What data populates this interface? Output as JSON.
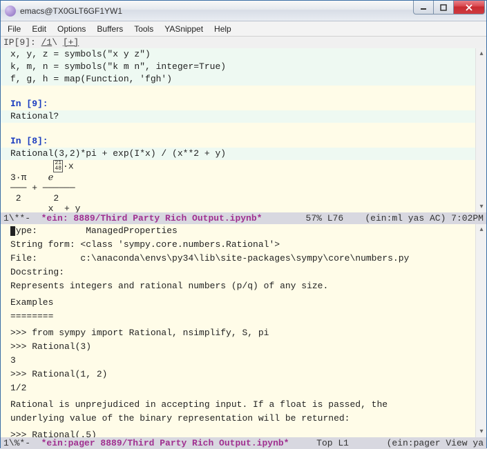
{
  "window": {
    "title": "emacs@TX0GLT6GF1YW1"
  },
  "menu": {
    "file": "File",
    "edit": "Edit",
    "options": "Options",
    "buffers": "Buffers",
    "tools": "Tools",
    "yasnippet": "YASnippet",
    "help": "Help"
  },
  "tab": {
    "prefix": "IP[9]: ",
    "frac": "/1",
    "suffix": "\\ ",
    "plus": "[+]"
  },
  "top": {
    "l1": "x, y, z = symbols(\"x y z\")",
    "l2": "k, m, n = symbols(\"k m n\", integer=True)",
    "l3": "f, g, h = map(Function, 'fgh')",
    "inp9": "In [9]:",
    "l4": "Rational?",
    "inp8": "In [8]:",
    "l5": "Rational(3,2)*pi + exp(I*x) / (x**2 + y)",
    "box": "21\n48",
    "mx": "·x",
    "m1": "3·π    ℯ",
    "m2": "─── + ──────",
    "m3": " 2      2",
    "m4": "       x  + y"
  },
  "ml1": {
    "left": "1\\**-  ",
    "buf": "*ein: 8889/Third Party Rich Output.ipynb*",
    "mid": "   57% L76    (ein:ml yas AC) 7:02PM"
  },
  "doc": {
    "l1a": "ype:         ManagedProperties",
    "l2": "String form: <class 'sympy.core.numbers.Rational'>",
    "l3": "File:        c:\\anaconda\\envs\\py34\\lib\\site-packages\\sympy\\core\\numbers.py",
    "l4": "Docstring:",
    "l5": "Represents integers and rational numbers (p/q) of any size.",
    "l6": "",
    "l7": "Examples",
    "l8": "========",
    "l9": "",
    "l10": ">>> from sympy import Rational, nsimplify, S, pi",
    "l11": ">>> Rational(3)",
    "l12": "3",
    "l13": ">>> Rational(1, 2)",
    "l14": "1/2",
    "l15": "",
    "l16": "Rational is unprejudiced in accepting input. If a float is passed, the",
    "l17": "underlying value of the binary representation will be returned:",
    "l18": "",
    "l19": ">>> Rational(.5)"
  },
  "ml2": {
    "left": "1\\%*-  ",
    "buf": "*ein:pager 8889/Third Party Rich Output.ipynb*",
    "mid": "   Top L1       (ein:pager View ya"
  }
}
